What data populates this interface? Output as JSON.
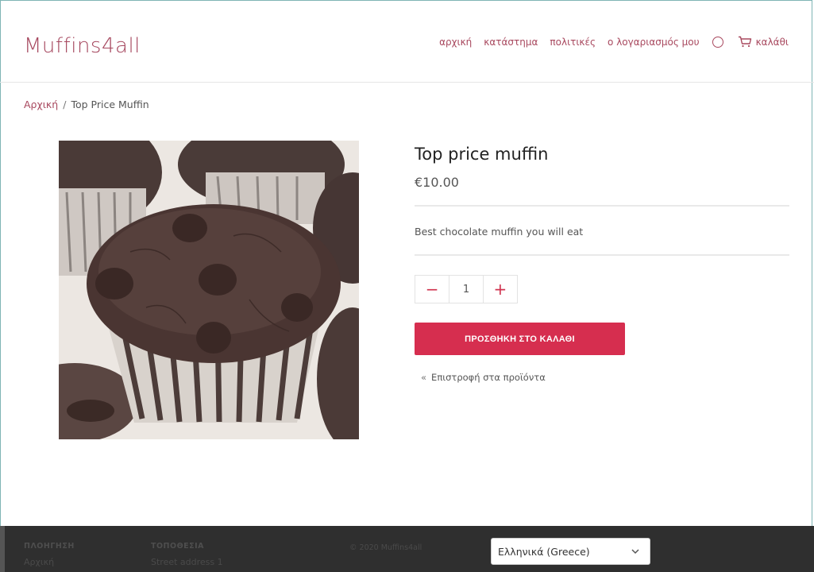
{
  "header": {
    "logo": "Muffins4all",
    "nav": [
      "αρχική",
      "κατάστημα",
      "πολιτικές",
      "ο λογαριασμός μου"
    ],
    "cart_label": "καλάθι"
  },
  "breadcrumb": {
    "home": "Αρχική",
    "separator": "/",
    "current": "Top Price Muffin"
  },
  "product": {
    "title": "Top price muffin",
    "price": "€10.00",
    "description": "Best chocolate muffin you will eat",
    "quantity": "1",
    "minus": "−",
    "plus": "+",
    "add_to_cart": "ΠΡΟΣΘΗΚΗ ΣΤΟ ΚΑΛΑΘΙ",
    "back_arrow": "«",
    "back_link": "Επιστροφή στα προϊόντα"
  },
  "footer": {
    "nav_heading": "ΠΛΟΗΓΗΣΗ",
    "nav_item": "Αρχική",
    "location_heading": "ΤΟΠΟΘΕΣΙΑ",
    "location_line": "Street address 1",
    "copyright": "© 2020 Muffins4all",
    "language": "Ελληνικά (Greece)"
  },
  "colors": {
    "brand": "#a8485e",
    "accent_button": "#d62e4f",
    "footer_bg": "#2f2f2f"
  },
  "icons": [
    "search-icon",
    "cart-icon",
    "chevron-down-icon"
  ]
}
